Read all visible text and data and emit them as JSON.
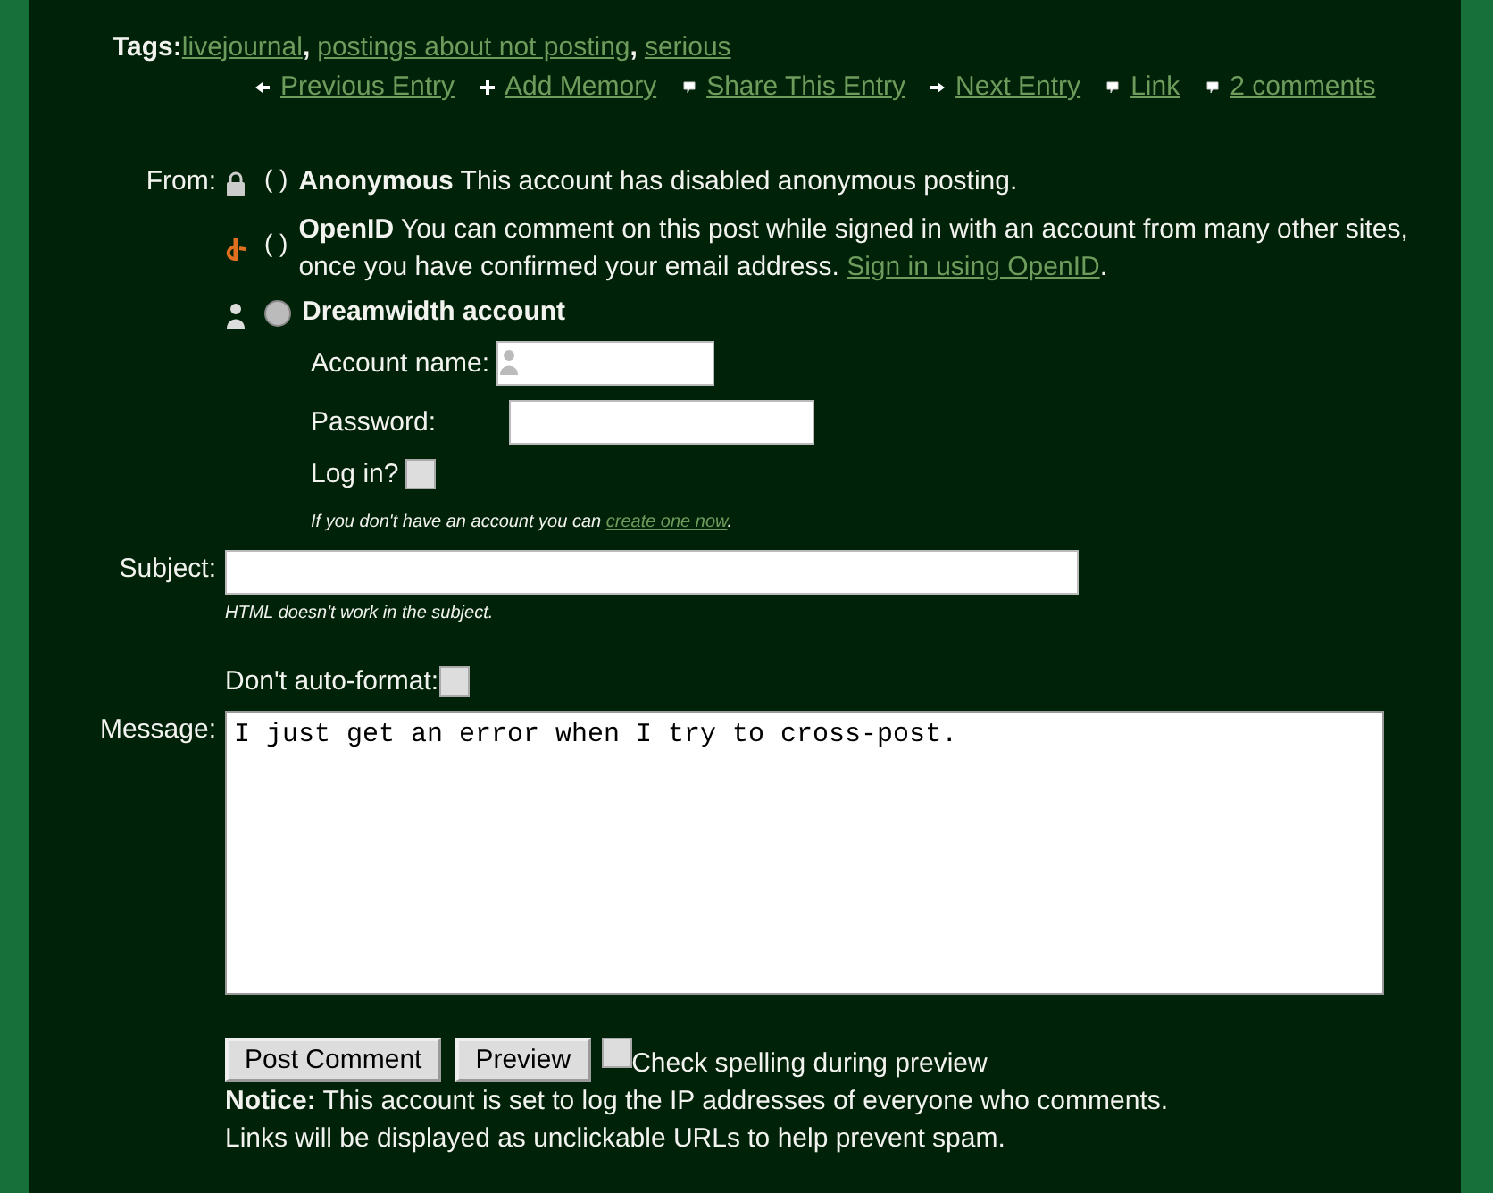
{
  "tags": {
    "label": "Tags:",
    "items": [
      "livejournal",
      "postings about not posting",
      "serious"
    ],
    "separator": ","
  },
  "entry_nav": [
    {
      "kind": "prev",
      "label": "Previous Entry"
    },
    {
      "kind": "add",
      "label": "Add Memory"
    },
    {
      "kind": "bubble",
      "label": "Share This Entry"
    },
    {
      "kind": "next",
      "label": "Next Entry"
    },
    {
      "kind": "bubble",
      "label": "Link"
    },
    {
      "kind": "bubble",
      "label": "2 comments"
    }
  ],
  "from": {
    "label": "From:",
    "options": [
      {
        "kind": "anonymous",
        "radio": "( )",
        "name": "Anonymous",
        "description": "This account has disabled anonymous posting."
      },
      {
        "kind": "openid",
        "radio": "( )",
        "name": "OpenID",
        "description": "You can comment on this post while signed in with an account from many other sites, once you have confirmed your email address.",
        "link": "Sign in using OpenID",
        "after": "."
      },
      {
        "kind": "account",
        "selected": false,
        "name": "Dreamwidth account"
      }
    ]
  },
  "login": {
    "account_label": "Account name:",
    "password_label": "Password:",
    "login_label": "Log in?",
    "login_checked": false,
    "hint": "If you don't have an account you can",
    "hint_link": "create one now",
    "hint_after": "."
  },
  "subject": {
    "label": "Subject:",
    "hint": "HTML doesn't work in the subject."
  },
  "auto_format": {
    "label": "Don't auto-format:",
    "checked": false
  },
  "message": {
    "label": "Message:",
    "value": "I just get an error when I try to cross-post."
  },
  "buttons": [
    "Post Comment",
    "Preview"
  ],
  "spellcheck": {
    "label": "Check spelling during preview",
    "checked": false
  },
  "notice": {
    "label": "Notice:",
    "text": "This account is set to log the IP addresses of everyone who comments.",
    "note": "Links will be displayed as unclickable URLs to help prevent spam."
  }
}
